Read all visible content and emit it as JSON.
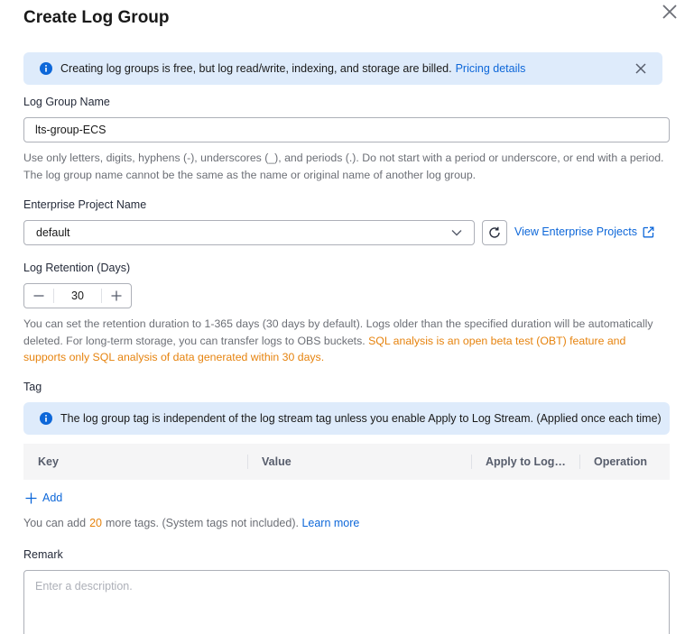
{
  "dialog": {
    "title": "Create Log Group"
  },
  "banner": {
    "text": "Creating log groups is free, but log read/write, indexing, and storage are billed.",
    "link": "Pricing details"
  },
  "log_group_name": {
    "label": "Log Group Name",
    "value": "lts-group-ECS",
    "hint": "Use only letters, digits, hyphens (-), underscores (_), and periods (.). Do not start with a period or underscore, or end with a period. The log group name cannot be the same as the name or original name of another log group."
  },
  "enterprise_project": {
    "label": "Enterprise Project Name",
    "selected": "default",
    "view_link": "View Enterprise Projects"
  },
  "retention": {
    "label": "Log Retention (Days)",
    "value": "30",
    "hint": "You can set the retention duration to 1-365 days (30 days by default). Logs older than the specified duration will be automatically deleted. For long-term storage, you can transfer logs to OBS buckets.",
    "warning": "SQL analysis is an open beta test (OBT) feature and supports only SQL analysis of data generated within 30 days."
  },
  "tag": {
    "label": "Tag",
    "banner": "The log group tag is independent of the log stream tag unless you enable Apply to Log Stream. (Applied once each time)",
    "columns": [
      "Key",
      "Value",
      "Apply to Log…",
      "Operation"
    ],
    "add_label": "Add",
    "quota_prefix": "You can add",
    "quota_count": "20",
    "quota_suffix": "more tags. (System tags not included).",
    "learn_more": "Learn more"
  },
  "remark": {
    "label": "Remark",
    "placeholder": "Enter a description."
  },
  "colors": {
    "accent": "#0d67d9",
    "warning": "#e6830e",
    "banner_bg": "#deebfb"
  }
}
